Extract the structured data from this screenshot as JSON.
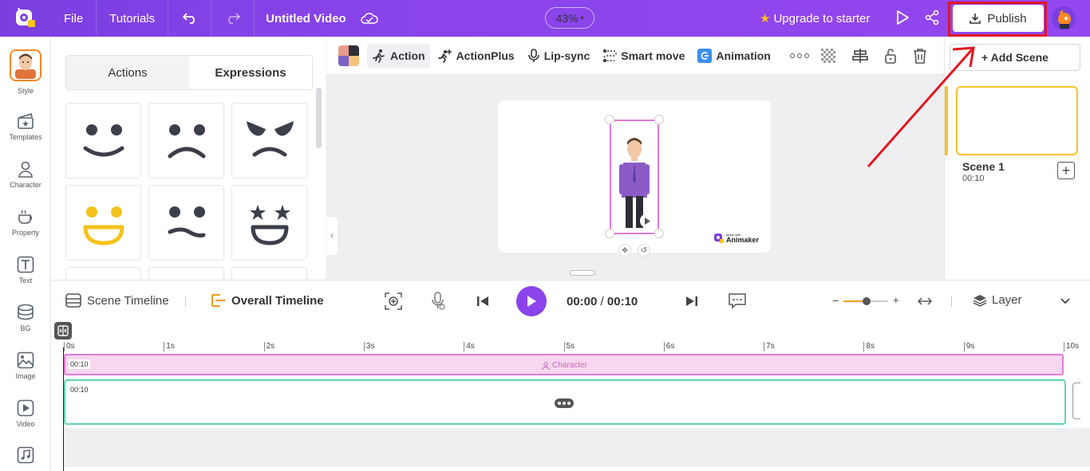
{
  "topbar": {
    "file": "File",
    "tutorials": "Tutorials",
    "title": "Untitled Video",
    "zoom": "43%",
    "upgrade": "Upgrade to starter",
    "publish": "Publish"
  },
  "sidebar": {
    "items": [
      {
        "label": "Style"
      },
      {
        "label": "Templates"
      },
      {
        "label": "Character"
      },
      {
        "label": "Property"
      },
      {
        "label": "Text"
      },
      {
        "label": "BG"
      },
      {
        "label": "Image"
      },
      {
        "label": "Video"
      }
    ]
  },
  "panel": {
    "tabs": [
      "Actions",
      "Expressions"
    ],
    "active_tab": "Expressions"
  },
  "toolbar": {
    "action": "Action",
    "actionplus": "ActionPlus",
    "lipsync": "Lip-sync",
    "smartmove": "Smart move",
    "animation": "Animation"
  },
  "canvas": {
    "watermark_small": "Made with",
    "watermark": "Animaker"
  },
  "scenes": {
    "add": "+ Add Scene",
    "items": [
      {
        "name": "Scene 1",
        "duration": "00:10"
      }
    ]
  },
  "timeline": {
    "scene_timeline": "Scene Timeline",
    "overall_timeline": "Overall Timeline",
    "current_time": "00:00",
    "separator": " / ",
    "total_time": "00:10",
    "layer": "Layer",
    "ticks": [
      "0s",
      "1s",
      "2s",
      "3s",
      "4s",
      "5s",
      "6s",
      "7s",
      "8s",
      "9s",
      "10s"
    ],
    "char_track_time": "00:10",
    "char_track_label": "Character",
    "scene_track_time": "00:10"
  },
  "colors": {
    "accent": "#8a44ea",
    "highlight": "#e3161f",
    "scene_border": "#f7c32c",
    "char_track": "#e37bd4",
    "scene_track": "#5cd6b0"
  }
}
